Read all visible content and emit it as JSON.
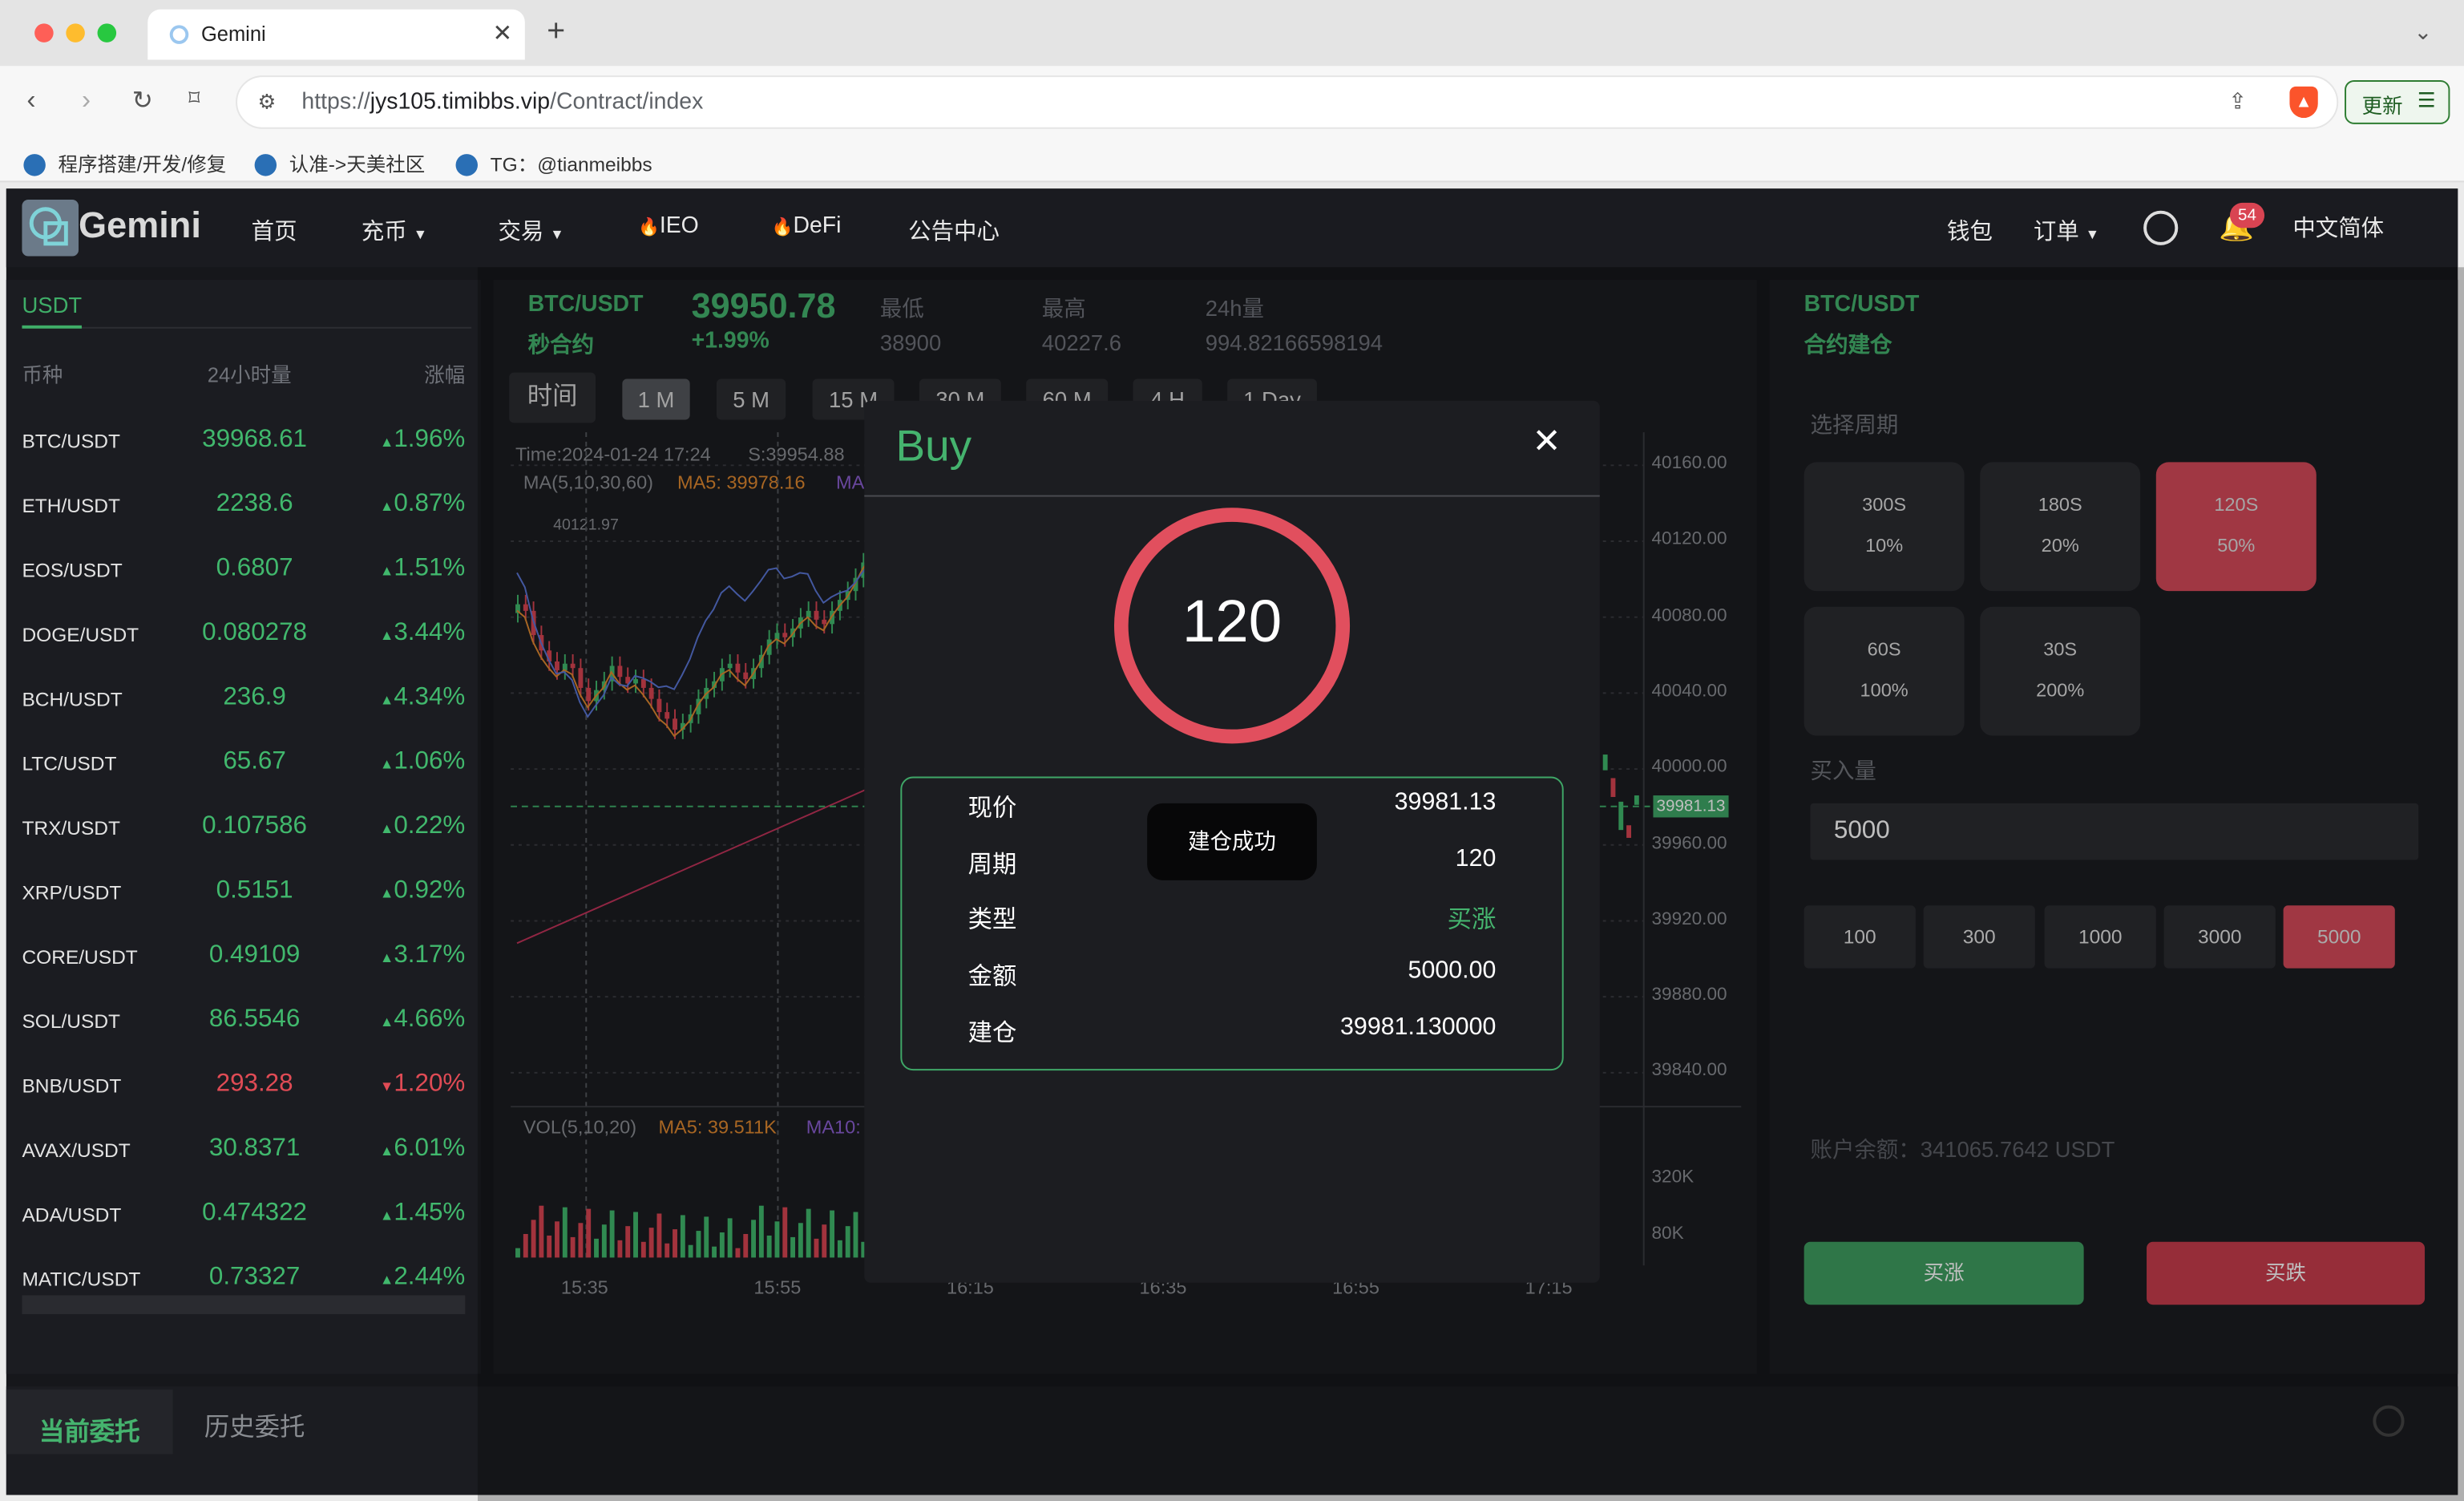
{
  "browser": {
    "tab_title": "Gemini",
    "url_scheme": "https://",
    "url_host": "jys105.timibbs.vip",
    "url_path": "/Contract/index",
    "update_label": "更新",
    "bookmarks": [
      "程序搭建/开发/修复",
      "认准->天美社区",
      "TG：@tianmeibbs"
    ]
  },
  "site": {
    "logo": "Gemini",
    "nav": [
      "首页",
      "充币",
      "交易",
      "IEO",
      "DeFi",
      "公告中心"
    ],
    "right_nav": [
      "钱包",
      "订单",
      "中文简体"
    ],
    "notif_count": "54"
  },
  "market": {
    "tab": "USDT",
    "headers": [
      "币种",
      "24小时量",
      "涨幅"
    ],
    "rows": [
      {
        "sym": "BTC/USDT",
        "price": "39968.61",
        "chg": "1.96%",
        "dir": "up"
      },
      {
        "sym": "ETH/USDT",
        "price": "2238.6",
        "chg": "0.87%",
        "dir": "up"
      },
      {
        "sym": "EOS/USDT",
        "price": "0.6807",
        "chg": "1.51%",
        "dir": "up"
      },
      {
        "sym": "DOGE/USDT",
        "price": "0.080278",
        "chg": "3.44%",
        "dir": "up"
      },
      {
        "sym": "BCH/USDT",
        "price": "236.9",
        "chg": "4.34%",
        "dir": "up"
      },
      {
        "sym": "LTC/USDT",
        "price": "65.67",
        "chg": "1.06%",
        "dir": "up"
      },
      {
        "sym": "TRX/USDT",
        "price": "0.107586",
        "chg": "0.22%",
        "dir": "up"
      },
      {
        "sym": "XRP/USDT",
        "price": "0.5151",
        "chg": "0.92%",
        "dir": "up"
      },
      {
        "sym": "CORE/USDT",
        "price": "0.49109",
        "chg": "3.17%",
        "dir": "up"
      },
      {
        "sym": "SOL/USDT",
        "price": "86.5546",
        "chg": "4.66%",
        "dir": "up"
      },
      {
        "sym": "BNB/USDT",
        "price": "293.28",
        "chg": "1.20%",
        "dir": "down"
      },
      {
        "sym": "AVAX/USDT",
        "price": "30.8371",
        "chg": "6.01%",
        "dir": "up"
      },
      {
        "sym": "ADA/USDT",
        "price": "0.474322",
        "chg": "1.45%",
        "dir": "up"
      },
      {
        "sym": "MATIC/USDT",
        "price": "0.73327",
        "chg": "2.44%",
        "dir": "up"
      }
    ]
  },
  "ticker": {
    "pair": "BTC/USDT",
    "sub": "秒合约",
    "price": "39950.78",
    "change": "+1.99%",
    "low_label": "最低",
    "low": "38900",
    "high_label": "最高",
    "high": "40227.6",
    "vol_label": "24h量",
    "vol": "994.82166598194"
  },
  "chart": {
    "time_label": "时间",
    "timeframes": [
      "1 M",
      "5 M",
      "15 M",
      "30 M",
      "60 M",
      "4 H",
      "1 Day"
    ],
    "info_time": "Time:2024-01-24 17:24",
    "info_s": "S:39954.88",
    "ma_label": "MA(5,10,30,60)",
    "ma5": "MA5: 39978.16",
    "ma_more": "MA",
    "peak_label": "40121.97",
    "price_ticks": [
      "40160.00",
      "40120.00",
      "40080.00",
      "40040.00",
      "40000.00",
      "39960.00",
      "39920.00",
      "39880.00",
      "39840.00"
    ],
    "current_price": "39981.13",
    "vol_label": "VOL(5,10,20)",
    "vol_ma5": "MA5: 39.511K",
    "vol_ma10": "MA10:",
    "vol_ticks": [
      "320K",
      "80K"
    ],
    "time_ticks": [
      "15:35",
      "15:55",
      "16:15",
      "16:35",
      "16:55",
      "17:15"
    ]
  },
  "trade": {
    "pair": "BTC/USDT",
    "sub": "合约建仓",
    "period_label": "选择周期",
    "cycles": [
      {
        "s": "300S",
        "p": "10%"
      },
      {
        "s": "180S",
        "p": "20%"
      },
      {
        "s": "120S",
        "p": "50%"
      },
      {
        "s": "60S",
        "p": "100%"
      },
      {
        "s": "30S",
        "p": "200%"
      }
    ],
    "amount_label": "买入量",
    "amount_value": "5000",
    "amounts": [
      "100",
      "300",
      "1000",
      "3000",
      "5000"
    ],
    "balance": "账户余额：341065.7642 USDT",
    "buy_up": "买涨",
    "buy_down": "买跌"
  },
  "orders": {
    "current": "当前委托",
    "history": "历史委托"
  },
  "modal": {
    "title": "Buy",
    "countdown": "120",
    "toast": "建仓成功",
    "rows": [
      {
        "k": "现价",
        "v": "39981.13"
      },
      {
        "k": "周期",
        "v": "120"
      },
      {
        "k": "类型",
        "v": "买涨"
      },
      {
        "k": "金额",
        "v": "5000.00"
      },
      {
        "k": "建仓",
        "v": "39981.130000"
      }
    ]
  },
  "colors": {
    "up": "#41b86d",
    "down": "#e04b55",
    "accent": "#e14f5e"
  }
}
